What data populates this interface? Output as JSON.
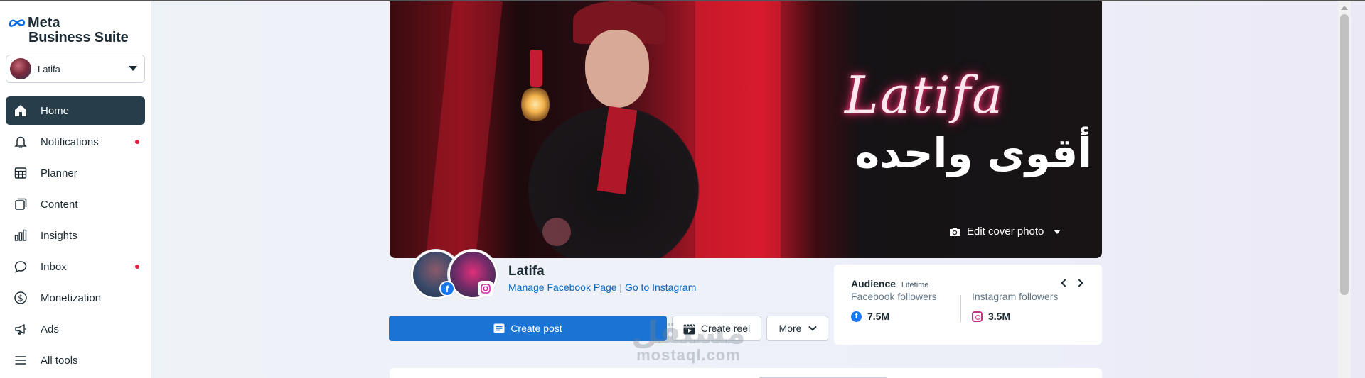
{
  "app": {
    "logo_line1": "Meta",
    "logo_line2": "Business Suite",
    "brand_color": "#0668e1"
  },
  "account": {
    "name": "Latifa"
  },
  "sidebar": {
    "items": [
      {
        "label": "Home",
        "icon": "home-icon",
        "active": true,
        "dot": false
      },
      {
        "label": "Notifications",
        "icon": "bell-icon",
        "active": false,
        "dot": true
      },
      {
        "label": "Planner",
        "icon": "calendar-icon",
        "active": false,
        "dot": false
      },
      {
        "label": "Content",
        "icon": "content-icon",
        "active": false,
        "dot": false
      },
      {
        "label": "Insights",
        "icon": "bar-chart-icon",
        "active": false,
        "dot": false
      },
      {
        "label": "Inbox",
        "icon": "chat-bubble-icon",
        "active": false,
        "dot": true
      },
      {
        "label": "Monetization",
        "icon": "dollar-icon",
        "active": false,
        "dot": false
      },
      {
        "label": "Ads",
        "icon": "megaphone-icon",
        "active": false,
        "dot": false
      },
      {
        "label": "All tools",
        "icon": "menu-icon",
        "active": false,
        "dot": false
      }
    ],
    "active_color": "#283d4a",
    "dot_color": "#e41e3f"
  },
  "cover": {
    "script_text": "Latifa",
    "arabic_text": "أقوى واحده",
    "edit_label": "Edit cover photo"
  },
  "profile": {
    "page_name": "Latifa",
    "manage_link": "Manage Facebook Page",
    "separator": "|",
    "instagram_link": "Go to Instagram"
  },
  "actions": {
    "create_post": "Create post",
    "create_reel": "Create reel",
    "more": "More",
    "primary_color": "#1b74d3"
  },
  "audience": {
    "title": "Audience",
    "subtitle": "Lifetime",
    "facebook_label": "Facebook followers",
    "facebook_value": "7.5M",
    "instagram_label": "Instagram followers",
    "instagram_value": "3.5M"
  },
  "watermark": {
    "arabic": "مستقل",
    "latin": "mostaql.com"
  }
}
